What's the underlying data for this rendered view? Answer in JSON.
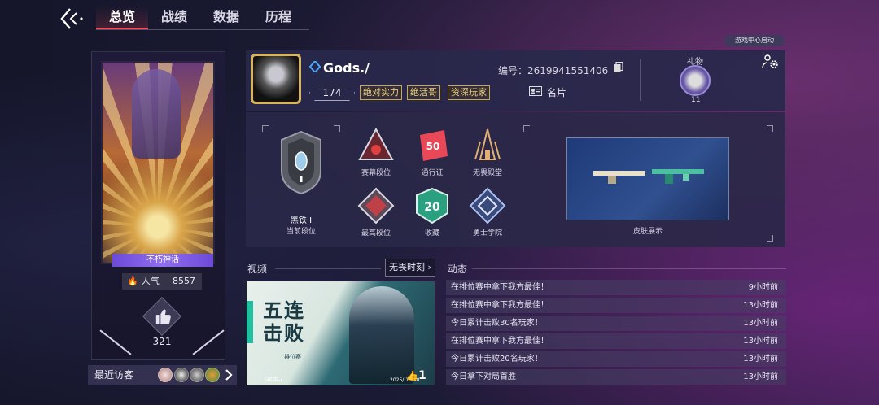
{
  "nav": {
    "tabs": [
      {
        "label": "总览",
        "active": true
      },
      {
        "label": "战绩",
        "active": false
      },
      {
        "label": "数据",
        "active": false
      },
      {
        "label": "历程",
        "active": false
      }
    ]
  },
  "left_card": {
    "title_banner": "不朽神话",
    "popularity_label": "人气",
    "popularity_value": "8557",
    "likes": "321",
    "visitors_label": "最近访客"
  },
  "profile": {
    "name": "Gods./",
    "level": "174",
    "tags": [
      "绝对实力",
      "绝活哥",
      "资深玩家"
    ],
    "id_text": "编号：2619941551406",
    "card_label": "名片",
    "gift_label": "礼物",
    "gift_count": "11",
    "launch_badge": "游戏中心启动"
  },
  "ranks": {
    "current_rank_name": "黑铁 I",
    "current_rank_label": "当前段位",
    "items": [
      {
        "label": "赛幕段位",
        "icon": "act-rank-icon"
      },
      {
        "label": "通行证",
        "icon": "battlepass-icon",
        "value": "50"
      },
      {
        "label": "无畏殿堂",
        "icon": "hall-icon"
      },
      {
        "label": "最高段位",
        "icon": "peak-rank-icon"
      },
      {
        "label": "收藏",
        "icon": "collection-icon",
        "value": "20"
      },
      {
        "label": "勇士学院",
        "icon": "academy-icon"
      }
    ],
    "skin_label": "皮肤展示"
  },
  "video": {
    "section_title": "视频",
    "link_label": "无畏时刻",
    "thumb_title_line1": "五连",
    "thumb_title_line2": "击败",
    "thumb_subtitle": "排位赛",
    "thumb_author": "Gods./",
    "thumb_likes": "1",
    "thumb_date": "2025/ 13:50"
  },
  "feed": {
    "section_title": "动态",
    "items": [
      {
        "text": "在排位赛中拿下我方最佳！",
        "time": "9小时前"
      },
      {
        "text": "在排位赛中拿下我方最佳！",
        "time": "13小时前"
      },
      {
        "text": "今日累计击败30名玩家！",
        "time": "13小时前"
      },
      {
        "text": "在排位赛中拿下我方最佳！",
        "time": "13小时前"
      },
      {
        "text": "今日累计击败20名玩家！",
        "time": "13小时前"
      },
      {
        "text": "今日拿下对局首胜",
        "time": "13小时前"
      }
    ]
  },
  "colors": {
    "accent_red": "#ff4a5a",
    "gold": "#d8b55a",
    "banner_purple": "#8f6ef0"
  }
}
